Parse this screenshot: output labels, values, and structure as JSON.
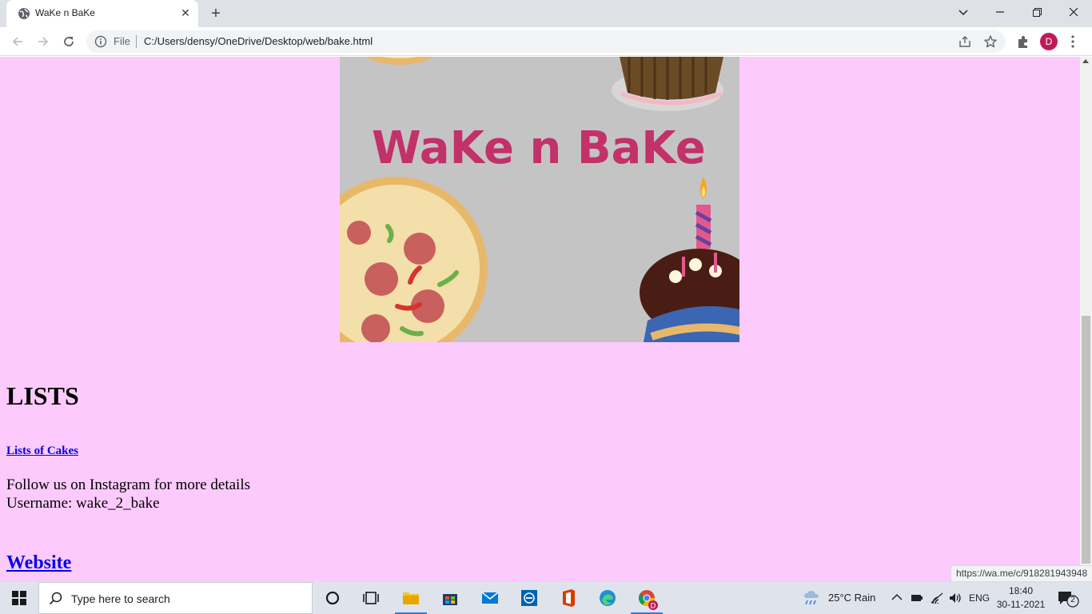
{
  "browser": {
    "tab_title": "WaKe n BaKe",
    "tab_close": "✕",
    "new_tab": "+",
    "file_label": "File",
    "url": "C:/Users/densy/OneDrive/Desktop/web/bake.html",
    "profile_initial": "D",
    "status_url": "https://wa.me/c/918281943948"
  },
  "window_controls": {
    "dropdown": "⌄",
    "minimize": "—",
    "restore": "❐",
    "close": "✕"
  },
  "page": {
    "banner_text": "WaKe n BaKe",
    "heading": "LISTS",
    "cakes_link": "Lists of Cakes",
    "follow_line1": "Follow us on Instagram for more details",
    "follow_line2": "Username: wake_2_bake",
    "website_link": "Website"
  },
  "taskbar": {
    "search_placeholder": "Type here to search",
    "weather": "25°C  Rain",
    "language": "ENG",
    "time": "18:40",
    "date": "30-11-2021",
    "notification_count": "2"
  },
  "colors": {
    "page_background": "#fccafd",
    "link": "#0000ee",
    "banner_title": "#c2185b",
    "profile": "#c2185b"
  }
}
